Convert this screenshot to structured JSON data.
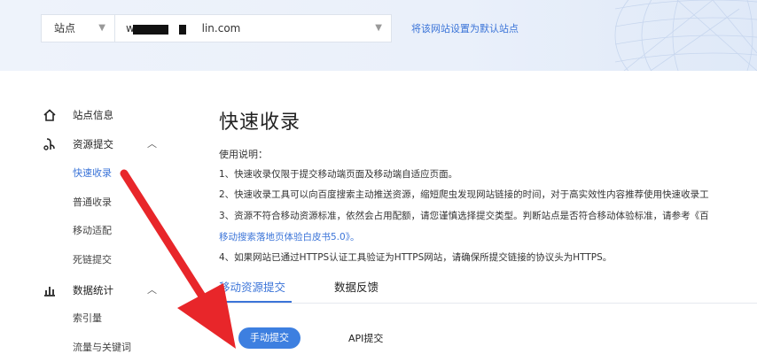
{
  "header": {
    "site_select": "站点",
    "domain_prefix": "ww",
    "domain_suffix": "lin.com",
    "set_default_link": "将该网站设置为默认站点"
  },
  "sidebar": {
    "site_info": "站点信息",
    "resource_submit": "资源提交",
    "resource_items": [
      "快速收录",
      "普通收录",
      "移动适配",
      "死链提交"
    ],
    "data_stats": "数据统计",
    "data_items": [
      "索引量",
      "流量与关键词"
    ]
  },
  "main": {
    "title": "快速收录",
    "usage_title": "使用说明：",
    "usage_lines": [
      "1、快速收录仅限于提交移动端页面及移动端自适应页面。",
      "2、快速收录工具可以向百度搜索主动推送资源，缩短爬虫发现网站链接的时间，对于高实效性内容推荐使用快速收录工",
      "3、资源不符合移动资源标准，依然会占用配额，请您谨慎选择提交类型。判断站点是否符合移动体验标准，请参考《百",
      "移动搜索落地页体验白皮书5.0》。",
      "4、如果网站已通过HTTPS认证工具验证为HTTPS网站，请确保所提交链接的协议头为HTTPS。"
    ],
    "tabs": [
      "移动资源提交",
      "数据反馈"
    ],
    "buttons": {
      "manual": "手动提交",
      "api": "API提交"
    }
  },
  "colors": {
    "accent": "#3b74d8",
    "annotation_arrow": "#e8262a"
  }
}
